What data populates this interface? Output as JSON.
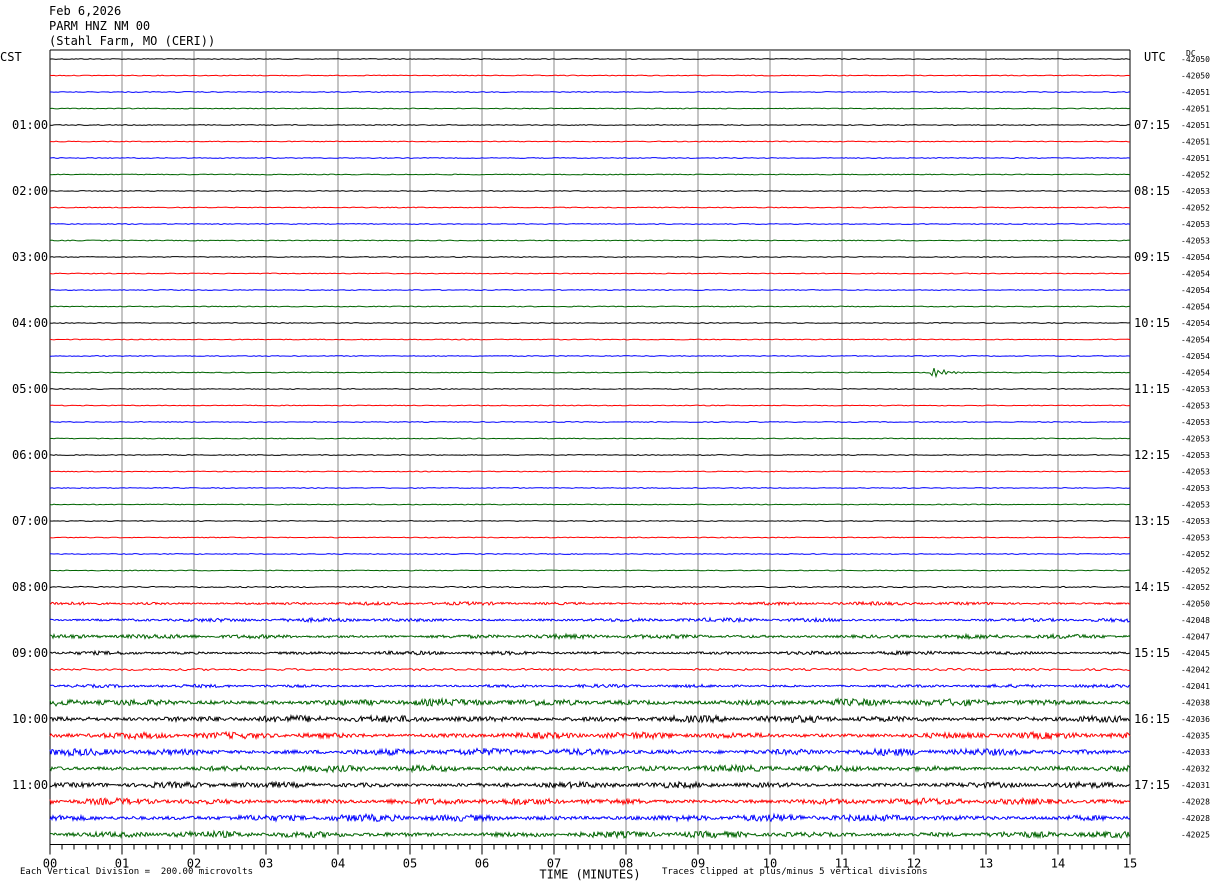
{
  "header": {
    "date": "Feb 6,2026",
    "station": "PARM HNZ NM 00",
    "location": "(Stahl Farm, MO (CERI))"
  },
  "footer": {
    "scale_note": "Each Vertical Division =  200.00 microvolts",
    "clip_note": "Traces clipped at plus/minus 5 vertical divisions"
  },
  "chart_data": {
    "type": "line",
    "title": "Feb 6,2026",
    "xlabel": "TIME (MINUTES)",
    "x_ticks": [
      "00",
      "01",
      "02",
      "03",
      "04",
      "05",
      "06",
      "07",
      "08",
      "09",
      "10",
      "11",
      "12",
      "13",
      "14",
      "15"
    ],
    "xlim": [
      0,
      15
    ],
    "left_axis_label": "CST",
    "right_axis_label": "UTC",
    "dc_label": "DC",
    "left_time_labels": [
      "01:00",
      "02:00",
      "03:00",
      "04:00",
      "05:00",
      "06:00",
      "07:00",
      "08:00",
      "09:00",
      "10:00",
      "11:00"
    ],
    "right_time_labels": [
      "07:15",
      "08:15",
      "09:15",
      "10:15",
      "11:15",
      "12:15",
      "13:15",
      "14:15",
      "15:15",
      "16:15",
      "17:15"
    ],
    "trace_colors": [
      "#000000",
      "#ff0000",
      "#0000ff",
      "#006400"
    ],
    "dc_offsets": [
      "-42050",
      "-42050",
      "-42051",
      "-42051",
      "-42051",
      "-42051",
      "-42051",
      "-42052",
      "-42053",
      "-42052",
      "-42053",
      "-42053",
      "-42054",
      "-42054",
      "-42054",
      "-42054",
      "-42054",
      "-42054",
      "-42054",
      "-42054",
      "-42053",
      "-42053",
      "-42053",
      "-42053",
      "-42053",
      "-42053",
      "-42053",
      "-42053",
      "-42053",
      "-42053",
      "-42052",
      "-42052",
      "-42052",
      "-42050",
      "-42048",
      "-42047",
      "-42045",
      "-42042",
      "-42041",
      "-42038",
      "-42036",
      "-42035",
      "-42033",
      "-42032",
      "-42031",
      "-42028",
      "-42028",
      "-42025"
    ],
    "trace_amplitude": [
      0.4,
      0.4,
      0.4,
      0.4,
      0.4,
      0.4,
      0.4,
      0.4,
      0.4,
      0.4,
      0.4,
      0.4,
      0.4,
      0.4,
      0.4,
      0.4,
      0.4,
      0.4,
      0.4,
      0.4,
      0.4,
      0.4,
      0.4,
      0.4,
      0.4,
      0.4,
      0.4,
      0.4,
      0.4,
      0.4,
      0.4,
      0.4,
      0.6,
      1.2,
      1.4,
      1.6,
      1.4,
      1.0,
      1.2,
      2.6,
      2.6,
      2.4,
      2.6,
      2.4,
      2.2,
      2.4,
      2.6,
      2.4
    ],
    "clip_divisions": 5,
    "vertical_division_microvolts": 200.0,
    "events": [
      {
        "trace": 19,
        "minute": 12.2,
        "amplitude": 8
      }
    ]
  }
}
